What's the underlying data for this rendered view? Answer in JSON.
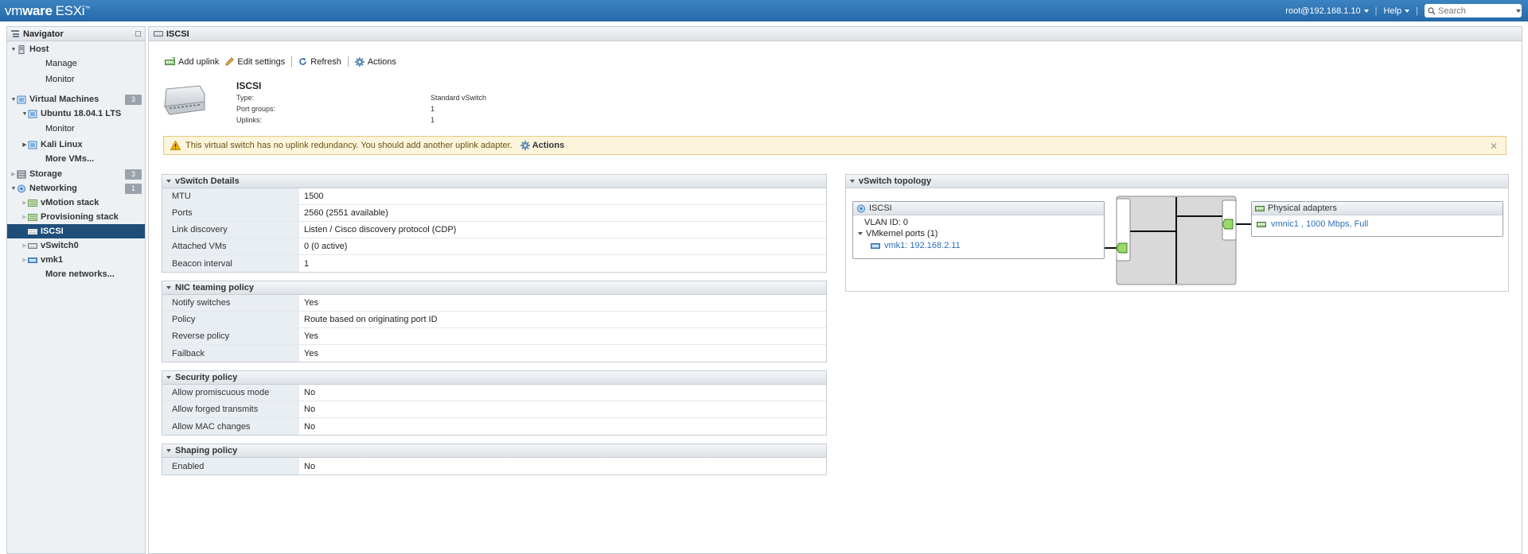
{
  "topbar": {
    "brand_vm": "vm",
    "brand_ware": "ware",
    "brand_product": "ESXi",
    "user": "root@192.168.1.10",
    "help": "Help",
    "search_placeholder": "Search"
  },
  "navigator": {
    "title": "Navigator",
    "items": [
      {
        "label": "Host"
      },
      {
        "label": "Manage"
      },
      {
        "label": "Monitor"
      },
      {
        "label": "Virtual Machines",
        "badge": "3"
      },
      {
        "label": "Ubuntu 18.04.1 LTS"
      },
      {
        "label": "Monitor"
      },
      {
        "label": "Kali Linux"
      },
      {
        "label": "More VMs..."
      },
      {
        "label": "Storage",
        "badge": "3"
      },
      {
        "label": "Networking",
        "badge": "1"
      },
      {
        "label": "vMotion stack"
      },
      {
        "label": "Provisioning stack"
      },
      {
        "label": "ISCSI"
      },
      {
        "label": "vSwitch0"
      },
      {
        "label": "vmk1"
      },
      {
        "label": "More networks..."
      }
    ]
  },
  "main": {
    "title": "ISCSI",
    "toolbar": {
      "add_uplink": "Add uplink",
      "edit_settings": "Edit settings",
      "refresh": "Refresh",
      "actions": "Actions"
    },
    "header": {
      "name": "ISCSI",
      "type_label": "Type:",
      "type_value": "Standard vSwitch",
      "portgroups_label": "Port groups:",
      "portgroups_value": "1",
      "uplinks_label": "Uplinks:",
      "uplinks_value": "1"
    },
    "alert": {
      "text": "This virtual switch has no uplink redundancy. You should add another uplink adapter.",
      "action": "Actions"
    },
    "vswitch_details": {
      "title": "vSwitch Details",
      "rows": [
        {
          "k": "MTU",
          "v": "1500"
        },
        {
          "k": "Ports",
          "v": "2560 (2551 available)"
        },
        {
          "k": "Link discovery",
          "v": "Listen / Cisco discovery protocol (CDP)"
        },
        {
          "k": "Attached VMs",
          "v": "0 (0 active)"
        },
        {
          "k": "Beacon interval",
          "v": "1"
        }
      ]
    },
    "nic_teaming": {
      "title": "NIC teaming policy",
      "rows": [
        {
          "k": "Notify switches",
          "v": "Yes"
        },
        {
          "k": "Policy",
          "v": "Route based on originating port ID"
        },
        {
          "k": "Reverse policy",
          "v": "Yes"
        },
        {
          "k": "Failback",
          "v": "Yes"
        }
      ]
    },
    "security": {
      "title": "Security policy",
      "rows": [
        {
          "k": "Allow promiscuous mode",
          "v": "No"
        },
        {
          "k": "Allow forged transmits",
          "v": "No"
        },
        {
          "k": "Allow MAC changes",
          "v": "No"
        }
      ]
    },
    "shaping": {
      "title": "Shaping policy",
      "rows": [
        {
          "k": "Enabled",
          "v": "No"
        }
      ]
    },
    "topology": {
      "title": "vSwitch topology",
      "portgroup": "ISCSI",
      "vlan": "VLAN ID: 0",
      "vmkernel_ports": "VMkernel ports (1)",
      "vmk": "vmk1: 192.168.2.11",
      "physical_adapters": "Physical adapters",
      "nic_name": "vmnic1",
      "nic_sep": " , ",
      "nic_speed": "1000 Mbps",
      "nic_sep2": ", ",
      "nic_duplex": "Full"
    }
  }
}
